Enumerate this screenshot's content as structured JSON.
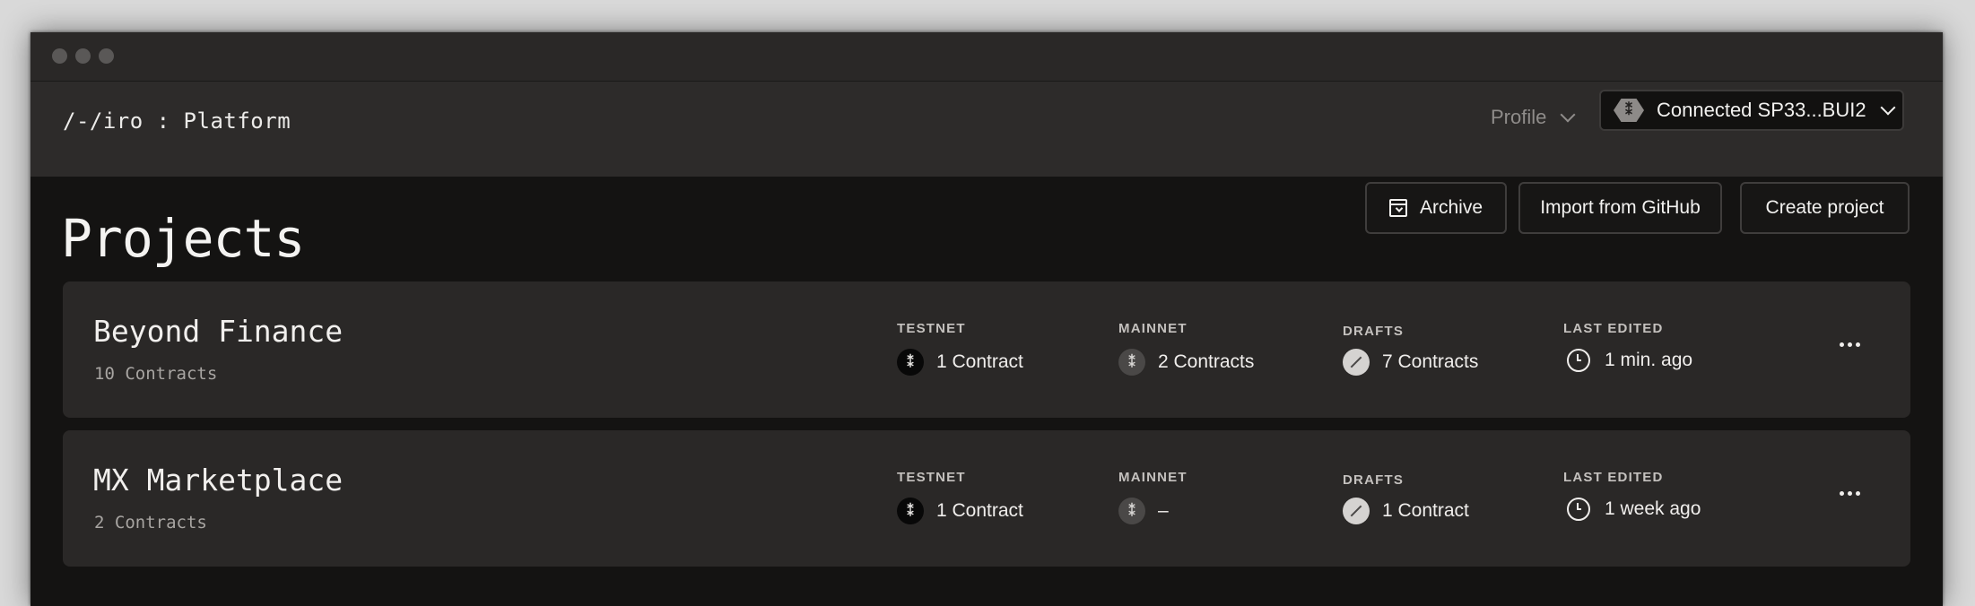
{
  "window": {
    "traffic_lights": [
      "close",
      "minimize",
      "zoom"
    ]
  },
  "header": {
    "logo": "/-/iro : Platform",
    "profile_label": "Profile",
    "wallet_label": "Connected SP33...BUI2",
    "wallet_icon": "stacks-hex-icon"
  },
  "main": {
    "title": "Projects",
    "actions": {
      "archive": "Archive",
      "import": "Import from GitHub",
      "create": "Create project"
    },
    "columns": {
      "testnet": "TESTNET",
      "mainnet": "MAINNET",
      "drafts": "DRAFTS",
      "last_edited": "LAST EDITED"
    },
    "projects": [
      {
        "name": "Beyond Finance",
        "contracts": "10 Contracts",
        "testnet": "1 Contract",
        "mainnet": "2 Contracts",
        "drafts": "7 Contracts",
        "last_edited": "1 min. ago"
      },
      {
        "name": "MX Marketplace",
        "contracts": "2 Contracts",
        "testnet": "1 Contract",
        "mainnet": "–",
        "drafts": "1 Contract",
        "last_edited": "1 week ago"
      }
    ]
  },
  "colors": {
    "background": "#141312",
    "navbar": "#2d2b2a",
    "card": "#2a2827",
    "text": "#f2f1ef",
    "muted": "#a8a5a2"
  }
}
